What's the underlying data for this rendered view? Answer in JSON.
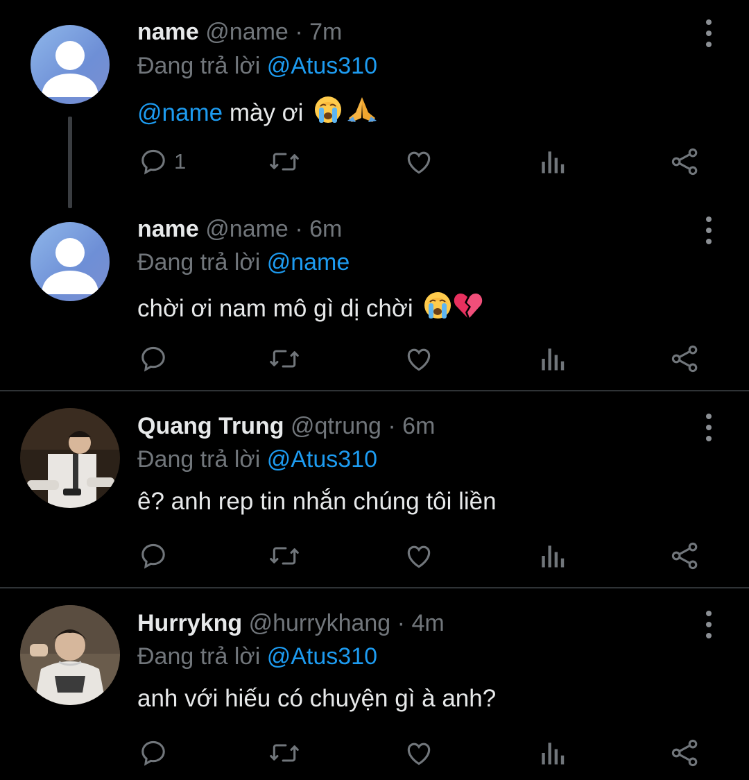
{
  "tweets": [
    {
      "name": "name",
      "handle": "@name",
      "dot": "·",
      "time": "7m",
      "reply_prefix": "Đang trả lời ",
      "reply_to": "@Atus310",
      "mention": "@name",
      "text": " mày ơi",
      "emojis": [
        "crying-face",
        "folded-hands"
      ],
      "reply_count": "1",
      "avatar": "default-avatar"
    },
    {
      "name": "name",
      "handle": "@name",
      "dot": "·",
      "time": "6m",
      "reply_prefix": "Đang trả lời ",
      "reply_to": "@name",
      "text": "chời ơi nam mô gì dị chời",
      "emojis": [
        "crying-face",
        "broken-heart"
      ],
      "reply_count": "",
      "avatar": "default-avatar"
    },
    {
      "name": "Quang Trung",
      "handle": "@qtrung",
      "dot": "·",
      "time": "6m",
      "reply_prefix": "Đang trả lời ",
      "reply_to": "@Atus310",
      "text": "ê? anh rep tin nhắn chúng tôi liền",
      "emojis": [],
      "reply_count": "",
      "avatar": "photo-avatar"
    },
    {
      "name": "Hurrykng",
      "handle": "@hurrykhang",
      "dot": "·",
      "time": "4m",
      "reply_prefix": "Đang trả lời ",
      "reply_to": "@Atus310",
      "text": "anh với hiếu có chuyện gì à anh?",
      "emojis": [],
      "reply_count": "",
      "avatar": "photo-avatar"
    }
  ],
  "icons": {
    "reply": "reply-icon",
    "retweet": "retweet-icon",
    "like": "heart-icon",
    "views": "views-icon",
    "share": "share-icon",
    "more": "more-options-icon"
  },
  "colors": {
    "background": "#000000",
    "text": "#e7e9ea",
    "secondary": "#71767b",
    "mention": "#1d9bf0",
    "divider": "#2f3336"
  }
}
